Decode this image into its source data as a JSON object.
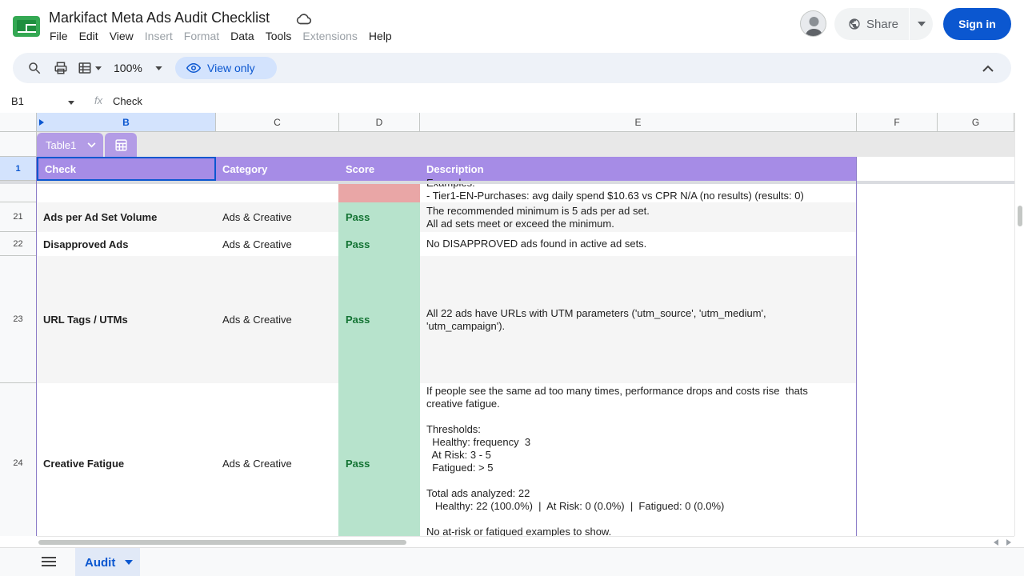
{
  "app": {
    "title": "Markifact Meta Ads Audit Checklist",
    "menu": [
      {
        "label": "File",
        "disabled": false
      },
      {
        "label": "Edit",
        "disabled": false
      },
      {
        "label": "View",
        "disabled": false
      },
      {
        "label": "Insert",
        "disabled": true
      },
      {
        "label": "Format",
        "disabled": true
      },
      {
        "label": "Data",
        "disabled": false
      },
      {
        "label": "Tools",
        "disabled": false
      },
      {
        "label": "Extensions",
        "disabled": true
      },
      {
        "label": "Help",
        "disabled": false
      }
    ],
    "share_label": "Share",
    "signin_label": "Sign in",
    "accent_color": "#0b57d0"
  },
  "toolbar": {
    "zoom": "100%",
    "view_only_label": "View only"
  },
  "formula_bar": {
    "cell_ref": "B1",
    "fx": "fx",
    "value": "Check"
  },
  "columns": [
    "B",
    "C",
    "D",
    "E",
    "F",
    "G"
  ],
  "table": {
    "name": "Table1",
    "header_color": "#a68ce6",
    "headers": {
      "check": "Check",
      "category": "Category",
      "score": "Score",
      "description": "Description"
    }
  },
  "rows": {
    "header_row_num": "1",
    "partial": {
      "desc_line1": "Examples:",
      "desc_line2": "- Tier1-EN-Purchases: avg daily spend $10.63 vs CPR N/A (no results) (results: 0)"
    },
    "r21": {
      "num": "21",
      "check": "Ads per Ad Set Volume",
      "category": "Ads & Creative",
      "score": "Pass",
      "desc": "The recommended minimum is 5 ads per ad set.\nAll ad sets meet or exceed the minimum."
    },
    "r22": {
      "num": "22",
      "check": "Disapproved Ads",
      "category": "Ads & Creative",
      "score": "Pass",
      "desc": "No DISAPPROVED ads found in active ad sets."
    },
    "r23": {
      "num": "23",
      "check": "URL Tags / UTMs",
      "category": "Ads & Creative",
      "score": "Pass",
      "desc": "All 22 ads have URLs with UTM parameters ('utm_source', 'utm_medium',\n'utm_campaign')."
    },
    "r24": {
      "num": "24",
      "check": "Creative Fatigue",
      "category": "Ads & Creative",
      "score": "Pass",
      "desc": "If people see the same ad too many times, performance drops and costs rise  thats\ncreative fatigue.\n\nThresholds:\n  Healthy: frequency  3\n  At Risk: 3 - 5\n  Fatigued: > 5\n\nTotal ads analyzed: 22\n   Healthy: 22 (100.0%)  |  At Risk: 0 (0.0%)  |  Fatigued: 0 (0.0%)\n\nNo at-risk or fatigued examples to show."
    }
  },
  "sheets": [
    {
      "label": "Audit",
      "active": true
    }
  ],
  "status_colors": {
    "pass": "#b7e3cc",
    "fail": "#e9a6a6"
  }
}
